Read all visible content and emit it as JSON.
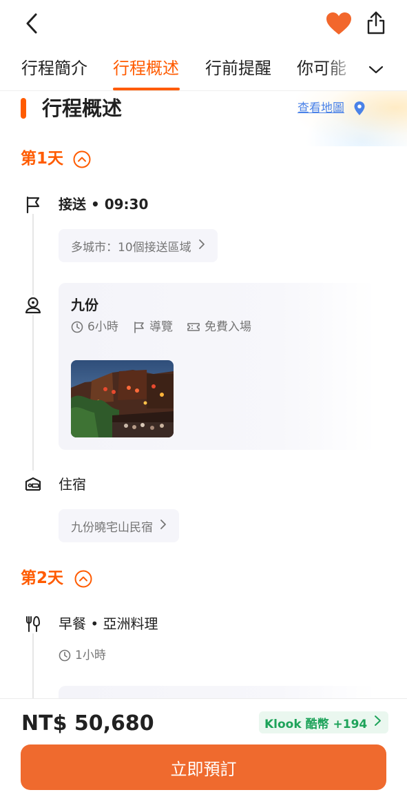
{
  "header": {
    "back_icon": "chevron-left-icon",
    "favorite_icon": "heart-filled-icon",
    "share_icon": "share-icon",
    "accent_color": "#ff5b00"
  },
  "tabs": [
    {
      "label": "行程簡介",
      "active": false
    },
    {
      "label": "行程概述",
      "active": true
    },
    {
      "label": "行前提醒",
      "active": false
    },
    {
      "label": "你可能",
      "active": false
    }
  ],
  "tabs_more_icon": "chevron-down-icon",
  "section": {
    "title": "行程概述",
    "map_link": "查看地圖"
  },
  "days": [
    {
      "label": "第1天",
      "items": [
        {
          "icon": "flag-icon",
          "title": "接送 • 09:30",
          "pill": "多城市：10個接送區域"
        },
        {
          "icon": "location-pin-icon",
          "title": "九份",
          "duration": "6小時",
          "guide": "導覽",
          "ticket": "免費入場"
        },
        {
          "icon": "bed-icon",
          "title": "住宿",
          "pill": "九份曉宅山民宿"
        }
      ]
    },
    {
      "label": "第2天",
      "items": [
        {
          "icon": "utensils-icon",
          "title": "早餐 • 亞洲料理",
          "duration": "1小時"
        }
      ]
    }
  ],
  "footer": {
    "price": "NT$ 50,680",
    "coins": "Klook 酷幣 +194",
    "book_button": "立即預訂",
    "button_color": "#ef6a2e",
    "coin_color": "#1ea35a"
  }
}
